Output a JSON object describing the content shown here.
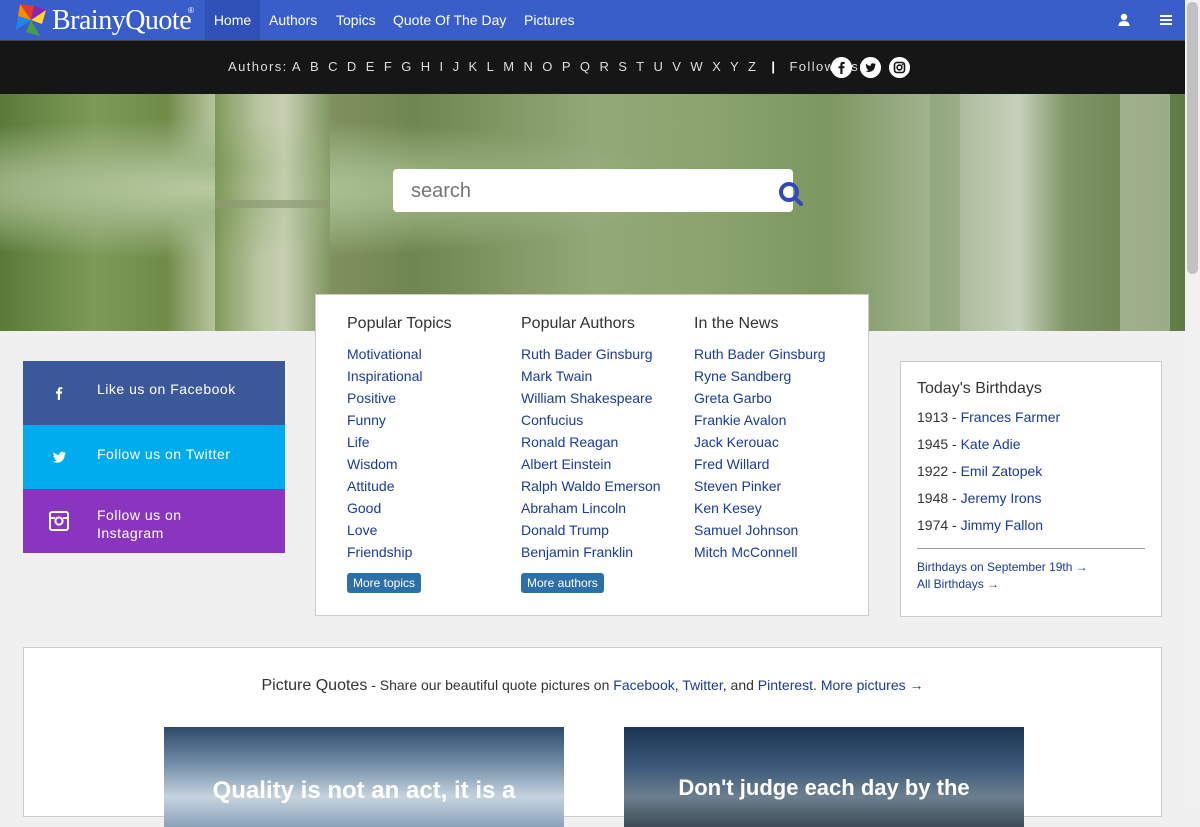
{
  "nav": {
    "logo_text": "BrainyQuote",
    "logo_reg": "®",
    "items": [
      {
        "label": "Home",
        "active": true
      },
      {
        "label": "Authors"
      },
      {
        "label": "Topics"
      },
      {
        "label": "Quote Of The Day"
      },
      {
        "label": "Pictures"
      }
    ],
    "user_icon": "user-icon",
    "menu_icon": "hamburger-menu-icon"
  },
  "letterbar": {
    "authors_label": "Authors:",
    "letters": [
      "A",
      "B",
      "C",
      "D",
      "E",
      "F",
      "G",
      "H",
      "I",
      "J",
      "K",
      "L",
      "M",
      "N",
      "O",
      "P",
      "Q",
      "R",
      "S",
      "T",
      "U",
      "V",
      "W",
      "X",
      "Y",
      "Z"
    ],
    "separator": "|",
    "follow_label": "Follow Us:",
    "social_icons": [
      "facebook-icon",
      "twitter-icon",
      "instagram-icon"
    ]
  },
  "search": {
    "placeholder": "search",
    "icon": "search-icon"
  },
  "social_blocks": [
    {
      "label": "Like us on Facebook",
      "icon": "facebook-icon",
      "color": "#3b5998"
    },
    {
      "label": "Follow us on Twitter",
      "icon": "twitter-icon",
      "color": "#00acee"
    },
    {
      "label": "Follow us on Instagram",
      "icon": "instagram-icon",
      "color": "#8a35bf"
    }
  ],
  "popular": {
    "topics": {
      "title": "Popular Topics",
      "items": [
        "Motivational",
        "Inspirational",
        "Positive",
        "Funny",
        "Life",
        "Wisdom",
        "Attitude",
        "Good",
        "Love",
        "Friendship"
      ],
      "button": "More topics"
    },
    "authors": {
      "title": "Popular Authors",
      "items": [
        "Ruth Bader Ginsburg",
        "Mark Twain",
        "William Shakespeare",
        "Confucius",
        "Ronald Reagan",
        "Albert Einstein",
        "Ralph Waldo Emerson",
        "Abraham Lincoln",
        "Donald Trump",
        "Benjamin Franklin"
      ],
      "button": "More authors"
    },
    "news": {
      "title": "In the News",
      "items": [
        "Ruth Bader Ginsburg",
        "Ryne Sandberg",
        "Greta Garbo",
        "Frankie Avalon",
        "Jack Kerouac",
        "Fred Willard",
        "Steven Pinker",
        "Ken Kesey",
        "Samuel Johnson",
        "Mitch McConnell"
      ]
    }
  },
  "birthdays": {
    "title": "Today's Birthdays",
    "entries": [
      {
        "year": "1913 - ",
        "name": "Frances Farmer"
      },
      {
        "year": "1945 - ",
        "name": "Kate Adie"
      },
      {
        "year": "1922 - ",
        "name": "Emil Zatopek"
      },
      {
        "year": "1948 - ",
        "name": "Jeremy Irons"
      },
      {
        "year": "1974 - ",
        "name": "Jimmy Fallon"
      }
    ],
    "link_date": "Birthdays on September 19th →",
    "link_all": "All Birthdays →"
  },
  "picture_quotes": {
    "title": "Picture Quotes",
    "dash": " - ",
    "text_before": "Share our beautiful quote pictures on ",
    "facebook": "Facebook",
    "comma": ", ",
    "twitter": "Twitter",
    "and": ", and ",
    "pinterest": "Pinterest",
    "period": ". ",
    "more": "More pictures →",
    "images": [
      {
        "quote": "Quality is not an act, it is a"
      },
      {
        "quote": "Don't judge each day by the"
      }
    ]
  },
  "colors": {
    "nav_bg": "#3a5ec9",
    "link": "#1a3a9c",
    "button": "#2d6fa8"
  }
}
